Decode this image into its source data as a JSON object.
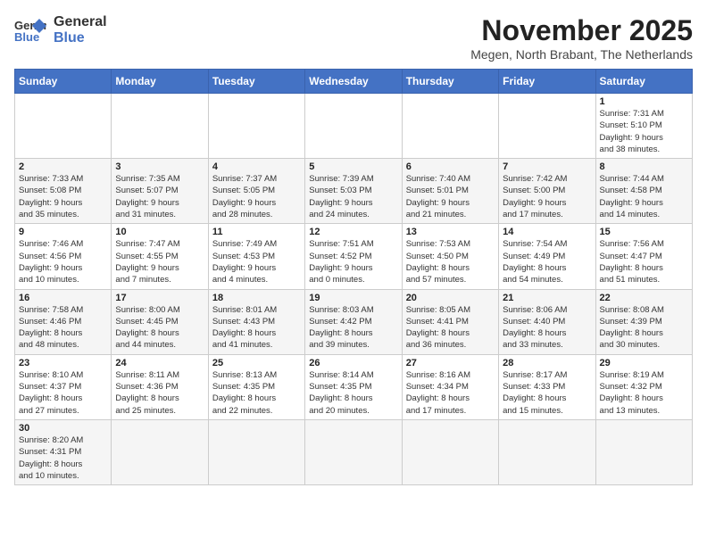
{
  "header": {
    "logo_general": "General",
    "logo_blue": "Blue",
    "month_title": "November 2025",
    "subtitle": "Megen, North Brabant, The Netherlands"
  },
  "weekdays": [
    "Sunday",
    "Monday",
    "Tuesday",
    "Wednesday",
    "Thursday",
    "Friday",
    "Saturday"
  ],
  "weeks": [
    [
      {
        "day": "",
        "info": ""
      },
      {
        "day": "",
        "info": ""
      },
      {
        "day": "",
        "info": ""
      },
      {
        "day": "",
        "info": ""
      },
      {
        "day": "",
        "info": ""
      },
      {
        "day": "",
        "info": ""
      },
      {
        "day": "1",
        "info": "Sunrise: 7:31 AM\nSunset: 5:10 PM\nDaylight: 9 hours\nand 38 minutes."
      }
    ],
    [
      {
        "day": "2",
        "info": "Sunrise: 7:33 AM\nSunset: 5:08 PM\nDaylight: 9 hours\nand 35 minutes."
      },
      {
        "day": "3",
        "info": "Sunrise: 7:35 AM\nSunset: 5:07 PM\nDaylight: 9 hours\nand 31 minutes."
      },
      {
        "day": "4",
        "info": "Sunrise: 7:37 AM\nSunset: 5:05 PM\nDaylight: 9 hours\nand 28 minutes."
      },
      {
        "day": "5",
        "info": "Sunrise: 7:39 AM\nSunset: 5:03 PM\nDaylight: 9 hours\nand 24 minutes."
      },
      {
        "day": "6",
        "info": "Sunrise: 7:40 AM\nSunset: 5:01 PM\nDaylight: 9 hours\nand 21 minutes."
      },
      {
        "day": "7",
        "info": "Sunrise: 7:42 AM\nSunset: 5:00 PM\nDaylight: 9 hours\nand 17 minutes."
      },
      {
        "day": "8",
        "info": "Sunrise: 7:44 AM\nSunset: 4:58 PM\nDaylight: 9 hours\nand 14 minutes."
      }
    ],
    [
      {
        "day": "9",
        "info": "Sunrise: 7:46 AM\nSunset: 4:56 PM\nDaylight: 9 hours\nand 10 minutes."
      },
      {
        "day": "10",
        "info": "Sunrise: 7:47 AM\nSunset: 4:55 PM\nDaylight: 9 hours\nand 7 minutes."
      },
      {
        "day": "11",
        "info": "Sunrise: 7:49 AM\nSunset: 4:53 PM\nDaylight: 9 hours\nand 4 minutes."
      },
      {
        "day": "12",
        "info": "Sunrise: 7:51 AM\nSunset: 4:52 PM\nDaylight: 9 hours\nand 0 minutes."
      },
      {
        "day": "13",
        "info": "Sunrise: 7:53 AM\nSunset: 4:50 PM\nDaylight: 8 hours\nand 57 minutes."
      },
      {
        "day": "14",
        "info": "Sunrise: 7:54 AM\nSunset: 4:49 PM\nDaylight: 8 hours\nand 54 minutes."
      },
      {
        "day": "15",
        "info": "Sunrise: 7:56 AM\nSunset: 4:47 PM\nDaylight: 8 hours\nand 51 minutes."
      }
    ],
    [
      {
        "day": "16",
        "info": "Sunrise: 7:58 AM\nSunset: 4:46 PM\nDaylight: 8 hours\nand 48 minutes."
      },
      {
        "day": "17",
        "info": "Sunrise: 8:00 AM\nSunset: 4:45 PM\nDaylight: 8 hours\nand 44 minutes."
      },
      {
        "day": "18",
        "info": "Sunrise: 8:01 AM\nSunset: 4:43 PM\nDaylight: 8 hours\nand 41 minutes."
      },
      {
        "day": "19",
        "info": "Sunrise: 8:03 AM\nSunset: 4:42 PM\nDaylight: 8 hours\nand 39 minutes."
      },
      {
        "day": "20",
        "info": "Sunrise: 8:05 AM\nSunset: 4:41 PM\nDaylight: 8 hours\nand 36 minutes."
      },
      {
        "day": "21",
        "info": "Sunrise: 8:06 AM\nSunset: 4:40 PM\nDaylight: 8 hours\nand 33 minutes."
      },
      {
        "day": "22",
        "info": "Sunrise: 8:08 AM\nSunset: 4:39 PM\nDaylight: 8 hours\nand 30 minutes."
      }
    ],
    [
      {
        "day": "23",
        "info": "Sunrise: 8:10 AM\nSunset: 4:37 PM\nDaylight: 8 hours\nand 27 minutes."
      },
      {
        "day": "24",
        "info": "Sunrise: 8:11 AM\nSunset: 4:36 PM\nDaylight: 8 hours\nand 25 minutes."
      },
      {
        "day": "25",
        "info": "Sunrise: 8:13 AM\nSunset: 4:35 PM\nDaylight: 8 hours\nand 22 minutes."
      },
      {
        "day": "26",
        "info": "Sunrise: 8:14 AM\nSunset: 4:35 PM\nDaylight: 8 hours\nand 20 minutes."
      },
      {
        "day": "27",
        "info": "Sunrise: 8:16 AM\nSunset: 4:34 PM\nDaylight: 8 hours\nand 17 minutes."
      },
      {
        "day": "28",
        "info": "Sunrise: 8:17 AM\nSunset: 4:33 PM\nDaylight: 8 hours\nand 15 minutes."
      },
      {
        "day": "29",
        "info": "Sunrise: 8:19 AM\nSunset: 4:32 PM\nDaylight: 8 hours\nand 13 minutes."
      }
    ],
    [
      {
        "day": "30",
        "info": "Sunrise: 8:20 AM\nSunset: 4:31 PM\nDaylight: 8 hours\nand 10 minutes."
      },
      {
        "day": "",
        "info": ""
      },
      {
        "day": "",
        "info": ""
      },
      {
        "day": "",
        "info": ""
      },
      {
        "day": "",
        "info": ""
      },
      {
        "day": "",
        "info": ""
      },
      {
        "day": "",
        "info": ""
      }
    ]
  ]
}
